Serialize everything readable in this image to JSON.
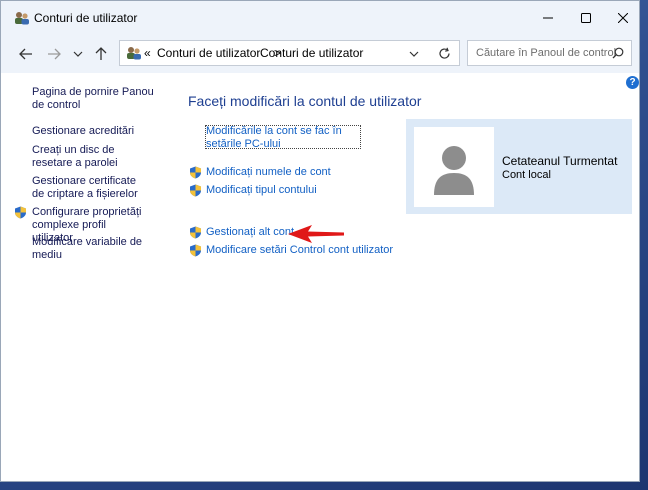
{
  "window": {
    "title": "Conturi de utilizator"
  },
  "nav": {
    "breadcrumb_prefix": "«",
    "breadcrumb_1": "Conturi de utilizator",
    "breadcrumb_sep": ">",
    "breadcrumb_2": "Conturi de utilizator",
    "search_placeholder": "Căutare în Panoul de control"
  },
  "sidebar": {
    "items": [
      {
        "label": "Pagina de pornire Panou de control"
      },
      {
        "label": "Gestionare acreditări"
      },
      {
        "label": "Creați un disc de resetare a parolei"
      },
      {
        "label": "Gestionare certificate de criptare a fișierelor"
      },
      {
        "label": "Configurare proprietăți complexe profil utilizator"
      },
      {
        "label": "Modificare variabile de mediu"
      }
    ]
  },
  "main": {
    "heading": "Faceți modificări la contul de utilizator",
    "task_pc_settings": "Modificările la cont se fac în setările PC-ului",
    "task_change_name": "Modificați numele de cont",
    "task_change_type": "Modificați tipul contului",
    "task_manage_other": "Gestionați alt cont",
    "task_uac": "Modificare setări Control cont utilizator"
  },
  "user": {
    "name": "Cetateanul Turmentat",
    "account_type": "Cont local"
  },
  "colors": {
    "link": "#1260c4",
    "heading": "#1e3f91",
    "panel": "#dce9f7",
    "arrow": "#e01818"
  }
}
